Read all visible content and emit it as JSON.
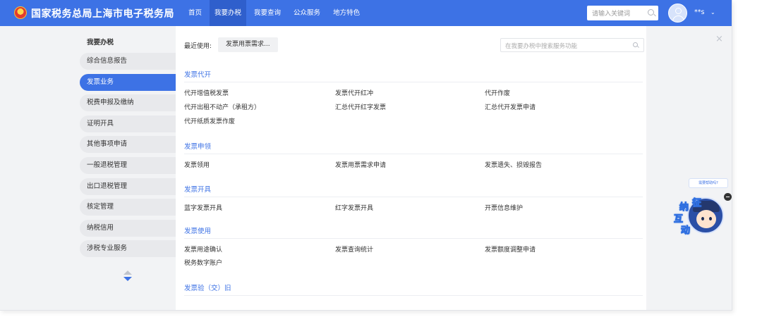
{
  "header": {
    "brand": "国家税务总局上海市电子税务局",
    "nav": [
      "首页",
      "我要办税",
      "我要查询",
      "公众服务",
      "地方特色"
    ],
    "active_nav": "我要办税",
    "search_placeholder": "请输入关键词",
    "username": "**s",
    "chevron": "⌄"
  },
  "sidebar": {
    "title": "我要办税",
    "items": [
      {
        "label": "综合信息报告"
      },
      {
        "label": "发票业务",
        "active": true
      },
      {
        "label": "税费申报及缴纳"
      },
      {
        "label": "证明开具"
      },
      {
        "label": "其他事项申请"
      },
      {
        "label": "一般退税管理"
      },
      {
        "label": "出口退税管理"
      },
      {
        "label": "核定管理"
      },
      {
        "label": "纳税信用"
      },
      {
        "label": "涉税专业服务"
      }
    ]
  },
  "panel": {
    "recent_label": "最近使用:",
    "recent_chip": "发票用票需求...",
    "search_placeholder": "在我要办税中搜索服务功能",
    "close": "×",
    "sections": [
      {
        "title": "发票代开",
        "links": [
          "代开增值税发票",
          "发票代开红冲",
          "代开作废",
          "代开出租不动产（承租方）",
          "汇总代开红字发票",
          "汇总代开发票申请",
          "代开纸质发票作废"
        ]
      },
      {
        "title": "发票申领",
        "links": [
          "发票领用",
          "发票用票需求申请",
          "发票遗失、损毁报告"
        ]
      },
      {
        "title": "发票开具",
        "links": [
          "蓝字发票开具",
          "红字发票开具",
          "开票信息维护"
        ]
      },
      {
        "title": "发票使用",
        "links": [
          "发票用途确认",
          "发票查询统计",
          "发票额度调整申请",
          "税务数字账户"
        ]
      },
      {
        "title": "发票验（交）旧",
        "links": []
      }
    ]
  },
  "helper": {
    "bubble": "需要帮助吗?",
    "chars": [
      "纳",
      "征",
      "互",
      "动"
    ]
  },
  "colors": {
    "brand_blue": "#3d72e5",
    "active_nav_bg": "#2f5fcc",
    "sidebar_bg": "#e8e9ec",
    "page_bg": "#f2f3f5"
  }
}
